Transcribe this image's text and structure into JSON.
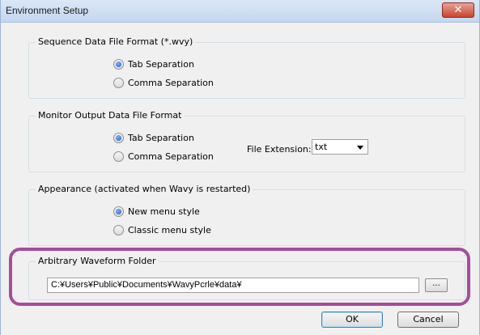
{
  "window": {
    "title": "Environment Setup",
    "close_label": "✕"
  },
  "sequence_format": {
    "legend": "Sequence Data File Format (*.wvy)",
    "options": [
      {
        "label": "Tab Separation",
        "checked": true
      },
      {
        "label": "Comma Separation",
        "checked": false
      }
    ]
  },
  "monitor_format": {
    "legend": "Monitor Output Data File Format",
    "options": [
      {
        "label": "Tab Separation",
        "checked": true
      },
      {
        "label": "Comma Separation",
        "checked": false
      }
    ],
    "extension_label": "File Extension:",
    "extension_value": "txt"
  },
  "appearance": {
    "legend": "Appearance (activated when Wavy is restarted)",
    "options": [
      {
        "label": "New menu style",
        "checked": true
      },
      {
        "label": "Classic menu style",
        "checked": false
      }
    ]
  },
  "waveform_folder": {
    "legend": "Arbitrary Waveform Folder",
    "path": "C:¥Users¥Public¥Documents¥WavyPcrle¥data¥",
    "browse_label": "..."
  },
  "buttons": {
    "ok": "OK",
    "cancel": "Cancel"
  },
  "colors": {
    "highlight": "#a54d9a",
    "titlebar": "#c4d7ef",
    "close": "#c9452f"
  }
}
